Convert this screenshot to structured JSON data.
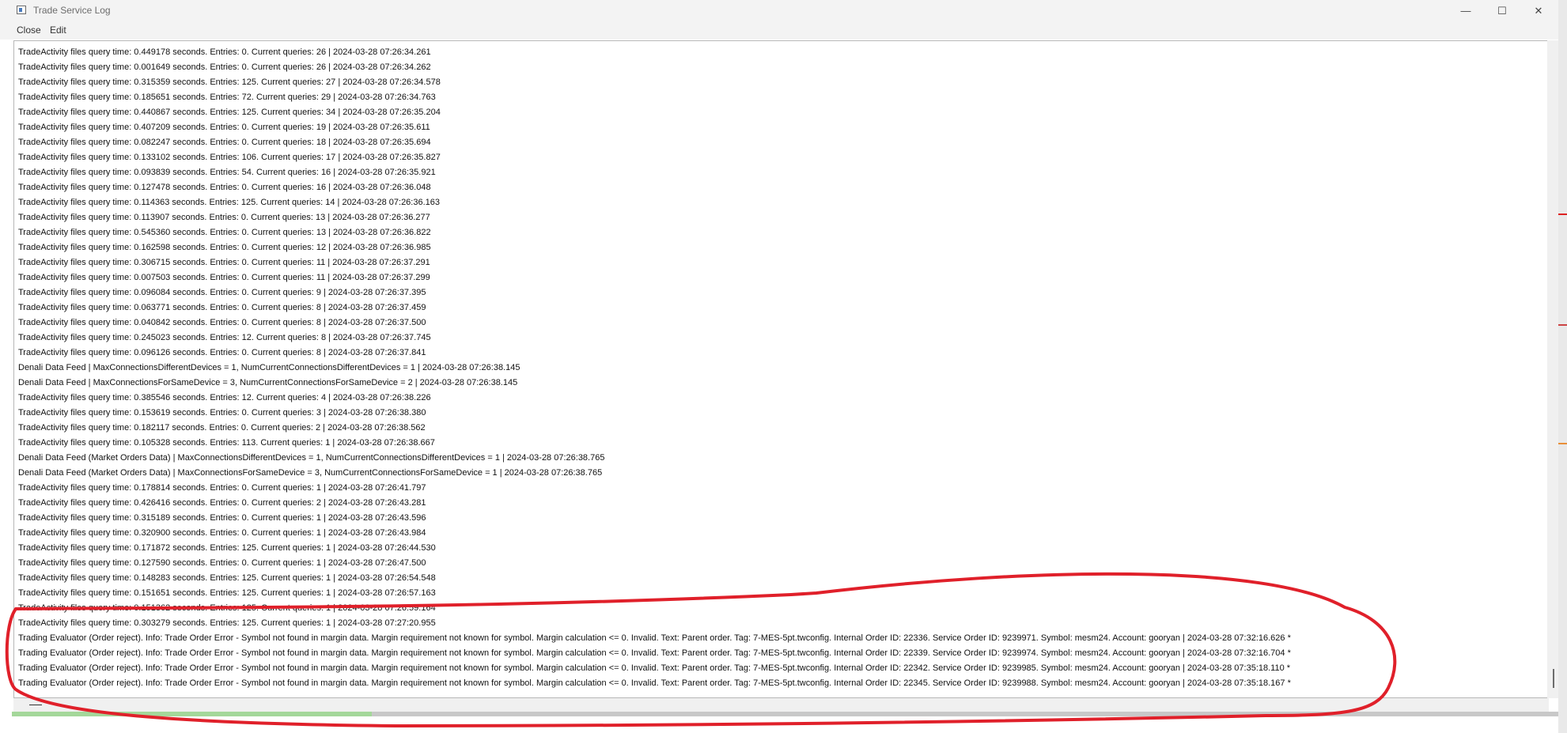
{
  "window": {
    "title": "Trade Service Log",
    "controls": {
      "minimize": "—",
      "maximize": "☐",
      "close": "✕"
    }
  },
  "menu": {
    "close": "Close",
    "edit": "Edit"
  },
  "log": {
    "lines": [
      "TradeActivity files query time: 0.449178 seconds. Entries: 0. Current queries: 26 | 2024-03-28  07:26:34.261",
      "TradeActivity files query time: 0.001649 seconds. Entries: 0. Current queries: 26 | 2024-03-28  07:26:34.262",
      "TradeActivity files query time: 0.315359 seconds. Entries: 125. Current queries: 27 | 2024-03-28  07:26:34.578",
      "TradeActivity files query time: 0.185651 seconds. Entries: 72. Current queries: 29 | 2024-03-28  07:26:34.763",
      "TradeActivity files query time: 0.440867 seconds. Entries: 125. Current queries: 34 | 2024-03-28  07:26:35.204",
      "TradeActivity files query time: 0.407209 seconds. Entries: 0. Current queries: 19 | 2024-03-28  07:26:35.611",
      "TradeActivity files query time: 0.082247 seconds. Entries: 0. Current queries: 18 | 2024-03-28  07:26:35.694",
      "TradeActivity files query time: 0.133102 seconds. Entries: 106. Current queries: 17 | 2024-03-28  07:26:35.827",
      "TradeActivity files query time: 0.093839 seconds. Entries: 54. Current queries: 16 | 2024-03-28  07:26:35.921",
      "TradeActivity files query time: 0.127478 seconds. Entries: 0. Current queries: 16 | 2024-03-28  07:26:36.048",
      "TradeActivity files query time: 0.114363 seconds. Entries: 125. Current queries: 14 | 2024-03-28  07:26:36.163",
      "TradeActivity files query time: 0.113907 seconds. Entries: 0. Current queries: 13 | 2024-03-28  07:26:36.277",
      "TradeActivity files query time: 0.545360 seconds. Entries: 0. Current queries: 13 | 2024-03-28  07:26:36.822",
      "TradeActivity files query time: 0.162598 seconds. Entries: 0. Current queries: 12 | 2024-03-28  07:26:36.985",
      "TradeActivity files query time: 0.306715 seconds. Entries: 0. Current queries: 11 | 2024-03-28  07:26:37.291",
      "TradeActivity files query time: 0.007503 seconds. Entries: 0. Current queries: 11 | 2024-03-28  07:26:37.299",
      "TradeActivity files query time: 0.096084 seconds. Entries: 0. Current queries: 9 | 2024-03-28  07:26:37.395",
      "TradeActivity files query time: 0.063771 seconds. Entries: 0. Current queries: 8 | 2024-03-28  07:26:37.459",
      "TradeActivity files query time: 0.040842 seconds. Entries: 0. Current queries: 8 | 2024-03-28  07:26:37.500",
      "TradeActivity files query time: 0.245023 seconds. Entries: 12. Current queries: 8 | 2024-03-28  07:26:37.745",
      "TradeActivity files query time: 0.096126 seconds. Entries: 0. Current queries: 8 | 2024-03-28  07:26:37.841",
      "Denali Data Feed | MaxConnectionsDifferentDevices = 1, NumCurrentConnectionsDifferentDevices = 1 | 2024-03-28  07:26:38.145",
      "Denali Data Feed | MaxConnectionsForSameDevice = 3, NumCurrentConnectionsForSameDevice = 2 | 2024-03-28  07:26:38.145",
      "TradeActivity files query time: 0.385546 seconds. Entries: 12. Current queries: 4 | 2024-03-28  07:26:38.226",
      "TradeActivity files query time: 0.153619 seconds. Entries: 0. Current queries: 3 | 2024-03-28  07:26:38.380",
      "TradeActivity files query time: 0.182117 seconds. Entries: 0. Current queries: 2 | 2024-03-28  07:26:38.562",
      "TradeActivity files query time: 0.105328 seconds. Entries: 113. Current queries: 1 | 2024-03-28  07:26:38.667",
      "Denali Data Feed (Market Orders Data) | MaxConnectionsDifferentDevices = 1, NumCurrentConnectionsDifferentDevices = 1 | 2024-03-28  07:26:38.765",
      "Denali Data Feed (Market Orders Data) | MaxConnectionsForSameDevice = 3, NumCurrentConnectionsForSameDevice = 1 | 2024-03-28  07:26:38.765",
      "TradeActivity files query time: 0.178814 seconds. Entries: 0. Current queries: 1 | 2024-03-28  07:26:41.797",
      "TradeActivity files query time: 0.426416 seconds. Entries: 0. Current queries: 2 | 2024-03-28  07:26:43.281",
      "TradeActivity files query time: 0.315189 seconds. Entries: 0. Current queries: 1 | 2024-03-28  07:26:43.596",
      "TradeActivity files query time: 0.320900 seconds. Entries: 0. Current queries: 1 | 2024-03-28  07:26:43.984",
      "TradeActivity files query time: 0.171872 seconds. Entries: 125. Current queries: 1 | 2024-03-28  07:26:44.530",
      "TradeActivity files query time: 0.127590 seconds. Entries: 0. Current queries: 1 | 2024-03-28  07:26:47.500",
      "TradeActivity files query time: 0.148283 seconds. Entries: 125. Current queries: 1 | 2024-03-28  07:26:54.548",
      "TradeActivity files query time: 0.151651 seconds. Entries: 125. Current queries: 1 | 2024-03-28  07:26:57.163",
      "TradeActivity files query time: 0.151362 seconds. Entries: 125. Current queries: 1 | 2024-03-28  07:26:59.164",
      "TradeActivity files query time: 0.303279 seconds. Entries: 125. Current queries: 1 | 2024-03-28  07:27:20.955",
      "Trading Evaluator (Order reject). Info: Trade Order Error - Symbol not found in margin data. Margin requirement not known for symbol. Margin calculation <= 0. Invalid. Text: Parent order. Tag: 7-MES-5pt.twconfig. Internal Order ID: 22336. Service Order ID: 9239971. Symbol: mesm24. Account: gooryan | 2024-03-28  07:32:16.626 *",
      "Trading Evaluator (Order reject). Info: Trade Order Error - Symbol not found in margin data. Margin requirement not known for symbol. Margin calculation <= 0. Invalid. Text: Parent order. Tag: 7-MES-5pt.twconfig. Internal Order ID: 22339. Service Order ID: 9239974. Symbol: mesm24. Account: gooryan | 2024-03-28  07:32:16.704 *",
      "Trading Evaluator (Order reject). Info: Trade Order Error - Symbol not found in margin data. Margin requirement not known for symbol. Margin calculation <= 0. Invalid. Text: Parent order. Tag: 7-MES-5pt.twconfig. Internal Order ID: 22342. Service Order ID: 9239985. Symbol: mesm24. Account: gooryan | 2024-03-28  07:35:18.110 *",
      "Trading Evaluator (Order reject). Info: Trade Order Error - Symbol not found in margin data. Margin requirement not known for symbol. Margin calculation <= 0. Invalid. Text: Parent order. Tag: 7-MES-5pt.twconfig. Internal Order ID: 22345. Service Order ID: 9239988. Symbol: mesm24. Account: gooryan | 2024-03-28  07:35:18.167 *"
    ]
  },
  "colors": {
    "annotation": "#e0202a",
    "chrome": "#f3f3f3"
  },
  "icons": {
    "app": "app-window-icon",
    "annotation": "red-freehand-circle"
  }
}
